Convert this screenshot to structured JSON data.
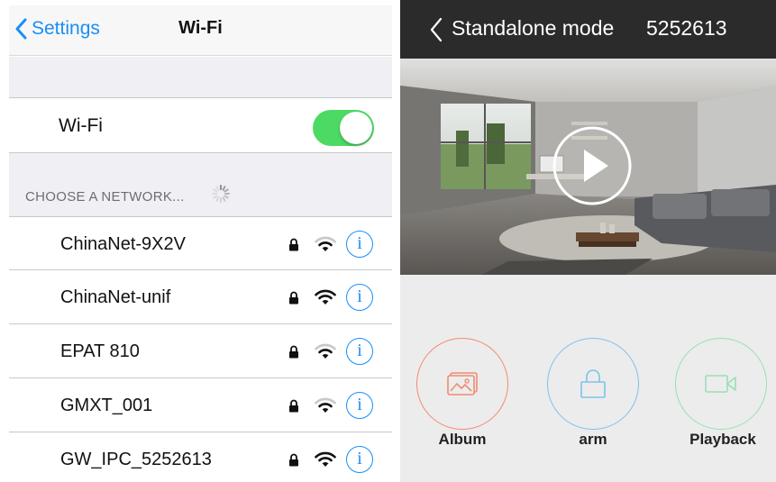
{
  "left": {
    "nav": {
      "back_label": "Settings",
      "title": "Wi-Fi"
    },
    "wifi_toggle": {
      "label": "Wi-Fi",
      "state": "on",
      "color": "#4cd964"
    },
    "section_header": "CHOOSE A NETWORK...",
    "networks": [
      {
        "name": "ChinaNet-9X2V",
        "locked": true,
        "signal": "medium"
      },
      {
        "name": "ChinaNet-unif",
        "locked": true,
        "signal": "full"
      },
      {
        "name": "EPAT 810",
        "locked": true,
        "signal": "medium"
      },
      {
        "name": "GMXT_001",
        "locked": true,
        "signal": "medium"
      },
      {
        "name": "GW_IPC_5252613",
        "locked": true,
        "signal": "full"
      }
    ],
    "info_glyph": "i",
    "accent_color": "#1a8ef5"
  },
  "right": {
    "header": {
      "title": "Standalone mode",
      "device_id": "5252613",
      "background": "#2b2b2b"
    },
    "video": {
      "state": "paused",
      "icon": "play-icon"
    },
    "actions": [
      {
        "label": "Album",
        "icon": "picture-icon",
        "color": "#f28a73"
      },
      {
        "label": "arm",
        "icon": "lock-icon",
        "color": "#7cc3ea"
      },
      {
        "label": "Playback",
        "icon": "video-camera-icon",
        "color": "#98dfb4"
      }
    ]
  }
}
